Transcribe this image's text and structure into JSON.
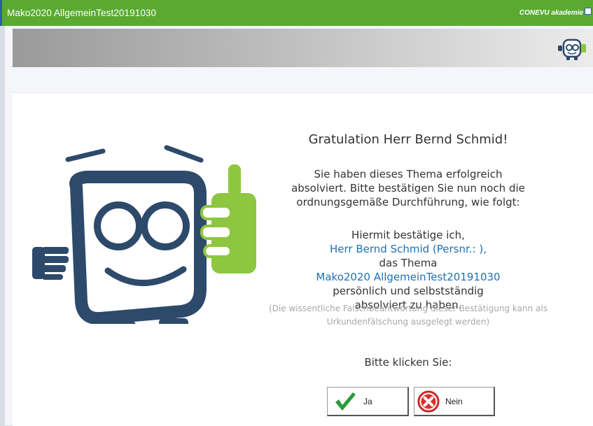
{
  "window": {
    "title": "Mako2020 AllgemeinTest20191030",
    "brand": "CONEVU akademie"
  },
  "content": {
    "heading": "Gratulation Herr Bernd Schmid!",
    "intro": [
      "Sie haben dieses Thema erfolgreich",
      "absolviert. Bitte bestätigen Sie nun noch die",
      "ordnungsgemäße Durchführung, wie folgt:"
    ],
    "confirm_line1": "Hiermit bestätige ich,",
    "person": "Herr Bernd Schmid (Persnr.: ),",
    "confirm_line3": "das Thema",
    "topic": "Mako2020 AllgemeinTest20191030",
    "confirm_line5": "persönlich und selbstständig",
    "confirm_line6": "absolviert zu haben.",
    "note_line1": "(Die wissentliche Falschbeantwortung dieser Bestätigung kann als",
    "note_line2": "Urkundenfälschung ausgelegt werden)",
    "prompt": "Bitte klicken Sie:"
  },
  "buttons": {
    "yes_label": "Ja",
    "no_label": "Nein"
  },
  "icons": {
    "yes": "checkmark-icon",
    "no": "red-x-icon",
    "logo": "conevu-mascot-logo"
  },
  "colors": {
    "titlebar": "#5aaa32",
    "accent_blue": "#1f6fb5",
    "mascot_navy": "#2d4a6b",
    "mascot_green": "#8dc63f"
  }
}
